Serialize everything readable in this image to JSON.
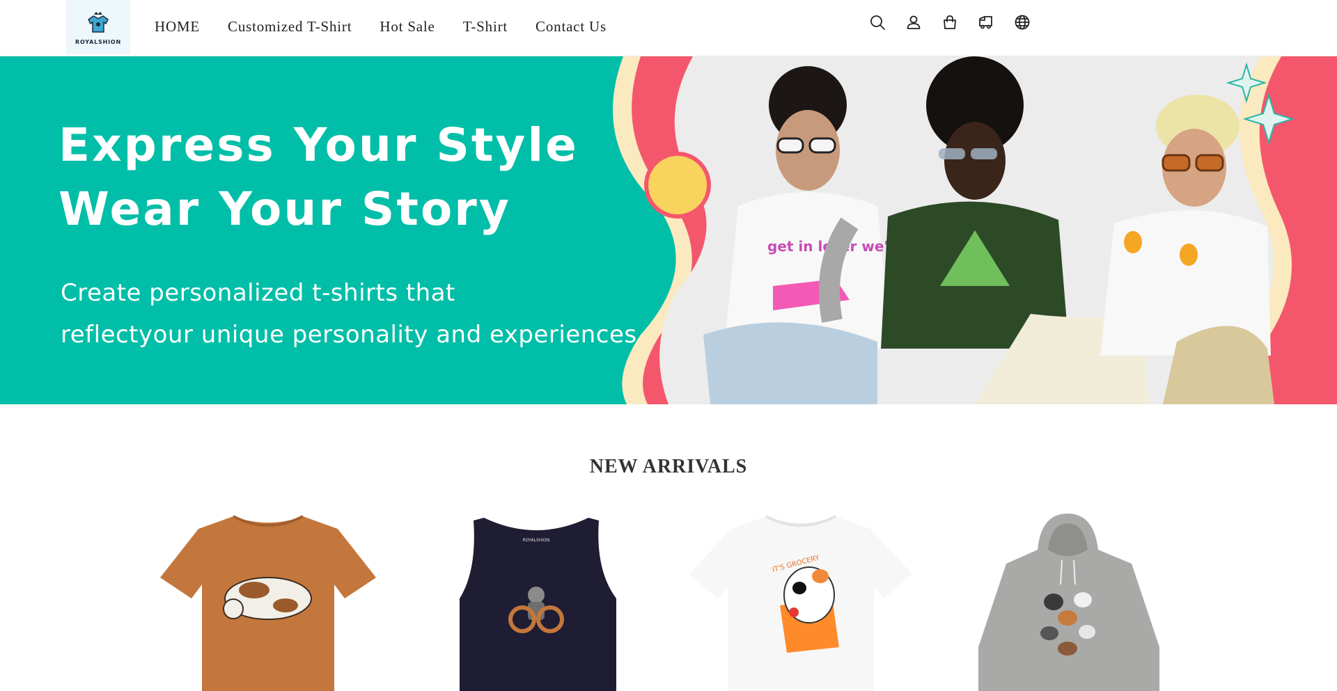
{
  "brand": {
    "name": "ROYALSHION"
  },
  "nav": {
    "items": [
      {
        "label": "HOME"
      },
      {
        "label": "Customized T-Shirt"
      },
      {
        "label": "Hot Sale"
      },
      {
        "label": "T-Shirt"
      },
      {
        "label": "Contact Us"
      }
    ]
  },
  "header_icons": [
    "search-icon",
    "account-icon",
    "cart-icon",
    "track-order-icon",
    "language-icon"
  ],
  "banner": {
    "title_line1": "Express Your Style",
    "title_line2": "Wear Your Story",
    "subtitle_line1": "Create personalized t-shirts that",
    "subtitle_line2": "reflectyour unique personality and experiences",
    "background_color": "#00bea7",
    "shirt_print_text": "get in loser we're going"
  },
  "new_arrivals": {
    "title": "NEW ARRIVALS",
    "products": [
      {
        "name": "orange cat t-shirt",
        "color": "#c4773c"
      },
      {
        "name": "navy cat bicycle tank top",
        "color": "#1f1d33"
      },
      {
        "name": "white cat grocery t-shirt",
        "color": "#f7f7f7"
      },
      {
        "name": "grey cats hoodie",
        "color": "#a9a9a7"
      }
    ]
  }
}
